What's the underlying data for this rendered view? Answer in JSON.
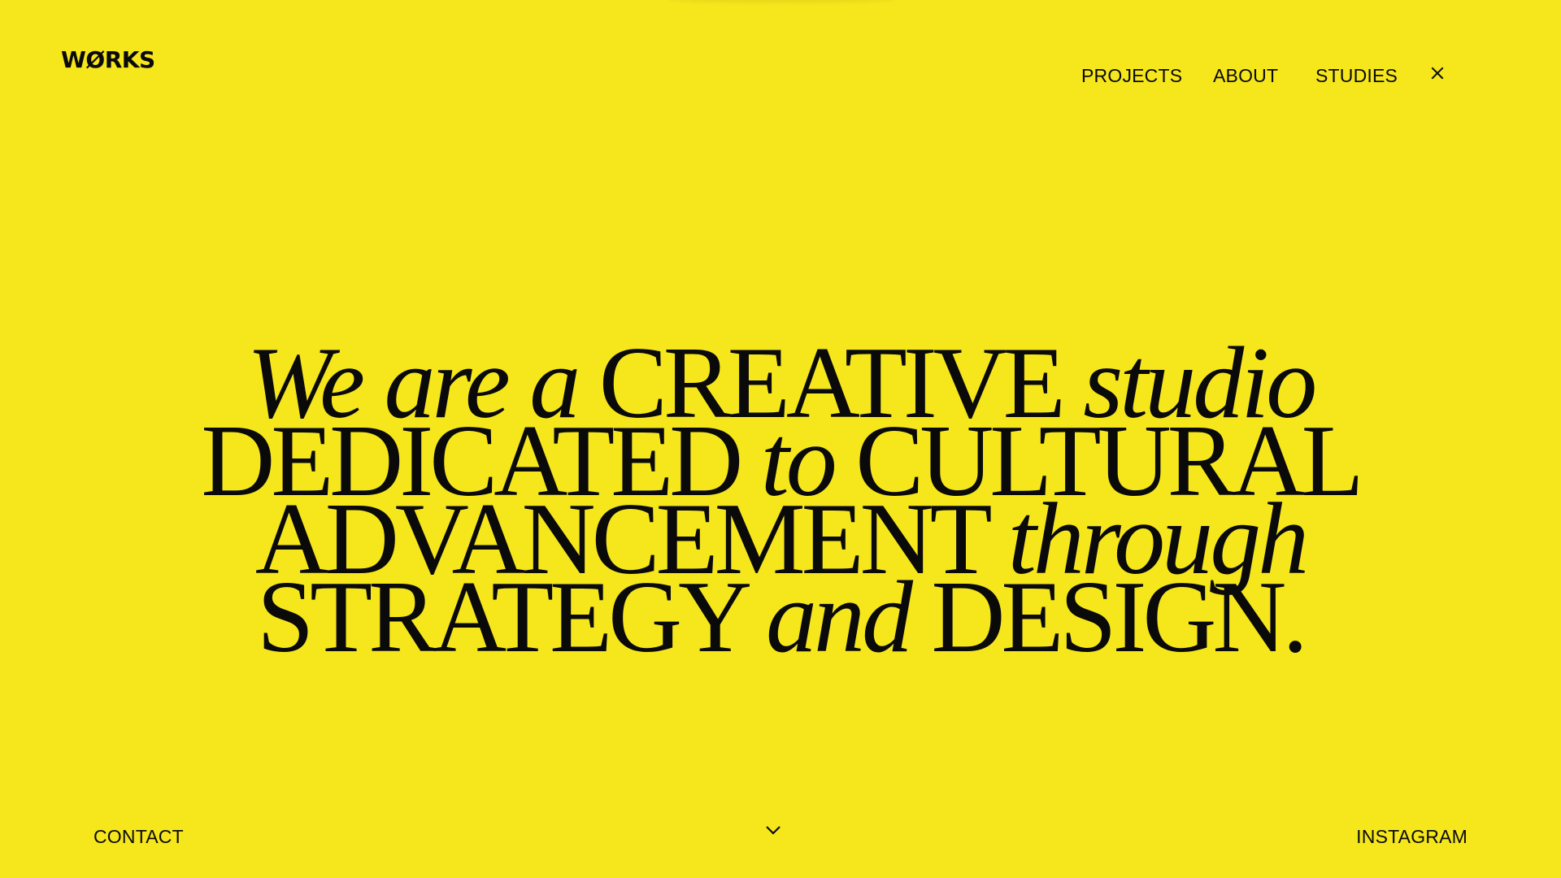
{
  "brand": {
    "logo_text": "WØRKS"
  },
  "nav": {
    "items": [
      {
        "label": "PROJECTS"
      },
      {
        "label": "ABOUT"
      },
      {
        "label": "STUDIES"
      }
    ],
    "close_icon": "close-icon"
  },
  "hero": {
    "lines": [
      [
        {
          "text": "We are a",
          "italic": true
        },
        {
          "text": "CREATIVE",
          "italic": false
        },
        {
          "text": "studio",
          "italic": true
        }
      ],
      [
        {
          "text": "DEDICATED",
          "italic": false
        },
        {
          "text": "to",
          "italic": true
        },
        {
          "text": "CULTURAL",
          "italic": false
        }
      ],
      [
        {
          "text": "ADVANCEMENT",
          "italic": false
        },
        {
          "text": "through",
          "italic": true
        }
      ],
      [
        {
          "text": "STRATEGY",
          "italic": false
        },
        {
          "text": "and",
          "italic": true
        },
        {
          "text": "DESIGN.",
          "italic": false
        }
      ]
    ]
  },
  "footer": {
    "contact_label": "CONTACT",
    "instagram_label": "INSTAGRAM",
    "scroll_icon": "chevron-down-icon"
  },
  "colors": {
    "background": "#f6e61c",
    "text": "#0a0a0a"
  }
}
